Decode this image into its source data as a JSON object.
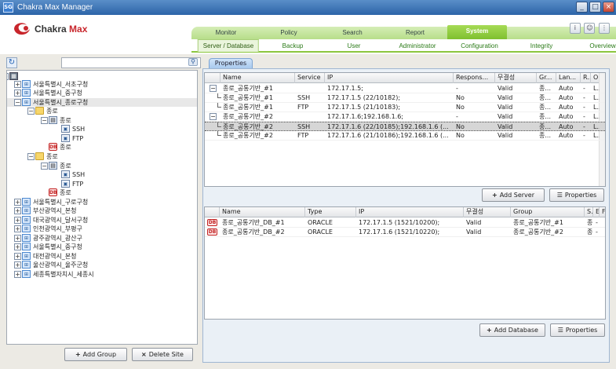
{
  "window": {
    "title": "Chakra Max Manager",
    "icon": "SG"
  },
  "brand": {
    "name": "Chakra",
    "suffix": "Max",
    "accent": "#c8262c"
  },
  "nav": {
    "tabs": [
      "Monitor",
      "Policy",
      "Search",
      "Report",
      "System"
    ],
    "active": "System",
    "subtabs": [
      "Server / Database",
      "Backup",
      "User",
      "Administrator",
      "Configuration",
      "Integrity",
      "Overview"
    ]
  },
  "header_icons": [
    "info-icon",
    "user-icon",
    "menu-icon"
  ],
  "search": {
    "value": ""
  },
  "tree": [
    {
      "label": "",
      "kind": "root"
    },
    {
      "label": "서울특별시_서초구청",
      "kind": "site"
    },
    {
      "label": "서울특별시_중구청",
      "kind": "site"
    },
    {
      "label": "서울특별시_종로구청",
      "kind": "site"
    },
    {
      "label": "종로",
      "kind": "folder"
    },
    {
      "label": "종로",
      "kind": "server"
    },
    {
      "label": "SSH",
      "kind": "svc"
    },
    {
      "label": "FTP",
      "kind": "svc"
    },
    {
      "label": "종로",
      "kind": "db"
    },
    {
      "label": "종로",
      "kind": "folder"
    },
    {
      "label": "종로",
      "kind": "server"
    },
    {
      "label": "SSH",
      "kind": "svc"
    },
    {
      "label": "FTP",
      "kind": "svc"
    },
    {
      "label": "종로",
      "kind": "db"
    },
    {
      "label": "서울특별시_구로구청",
      "kind": "site"
    },
    {
      "label": "부산광역시_본청",
      "kind": "site"
    },
    {
      "label": "대국광역시_달서구청",
      "kind": "site"
    },
    {
      "label": "인천광역시_부평구",
      "kind": "site"
    },
    {
      "label": "광주광역시_광산구",
      "kind": "site"
    },
    {
      "label": "서울특별시_중구청",
      "kind": "site"
    },
    {
      "label": "대전광역시_본청",
      "kind": "site"
    },
    {
      "label": "울산광역시_울주군청",
      "kind": "site"
    },
    {
      "label": "세종특별자치시_세종시",
      "kind": "site"
    }
  ],
  "left_buttons": {
    "add_group": "Add Group",
    "delete_site": "Delete Site"
  },
  "properties_tab": "Properties",
  "server_grid": {
    "columns": [
      "Name",
      "Service",
      "IP",
      "Respons...",
      "무결성",
      "Gr...",
      "Lan...",
      "R...",
      "O"
    ],
    "rows": [
      [
        "종로_공통기반_#1",
        "",
        "172.17.1.5;",
        "-",
        "Valid",
        "종...",
        "Auto",
        "-",
        "L..."
      ],
      [
        "종로_공통기반_#1",
        "SSH",
        "172.17.1.5 (22/10182);",
        "No",
        "Valid",
        "종...",
        "Auto",
        "-",
        "L..."
      ],
      [
        "종로_공통기반_#1",
        "FTP",
        "172.17.1.5 (21/10183);",
        "No",
        "Valid",
        "종...",
        "Auto",
        "-",
        "L..."
      ],
      [
        "종로_공통기반_#2",
        "",
        "172.17.1.6;192.168.1.6;",
        "-",
        "Valid",
        "종...",
        "Auto",
        "-",
        "L..."
      ],
      [
        "종로_공통기반_#2",
        "SSH",
        "172.17.1.6 (22/10185);192.168.1.6 (...",
        "No",
        "Valid",
        "종...",
        "Auto",
        "-",
        "L..."
      ],
      [
        "종로_공통기반_#2",
        "FTP",
        "172.17.1.6 (21/10186);192.168.1.6 (...",
        "No",
        "Valid",
        "종...",
        "Auto",
        "-",
        "L..."
      ]
    ],
    "selected_row": 4
  },
  "server_buttons": {
    "add_server": "Add Server",
    "properties": "Properties"
  },
  "db_grid": {
    "columns": [
      "Name",
      "Type",
      "IP",
      "무결성",
      "Group",
      "S.",
      "E",
      "F"
    ],
    "rows": [
      [
        "종로_공통기반_DB_#1",
        "ORACLE",
        "172.17.1.5 (1521/10200);",
        "Valid",
        "종로_공통기반_#1",
        "종",
        "-"
      ],
      [
        "종로_공통기반_DB_#2",
        "ORACLE",
        "172.17.1.6 (1521/10220);",
        "Valid",
        "종로_공통기반_#2",
        "종",
        "-"
      ]
    ]
  },
  "db_buttons": {
    "add_database": "Add Database",
    "properties": "Properties"
  }
}
